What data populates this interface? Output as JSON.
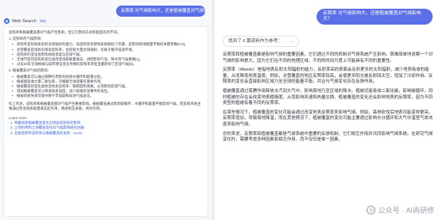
{
  "left": {
    "bubble": "反照率 对气候影响大，还是植被覆盖对气候影响大？",
    "source": "Web Search",
    "badge": "Pro",
    "intro": "反照率和植被覆盖都对气候产生影响，但它们影响方式和程度有所不同。",
    "s1": "1. 反照率的气候影响：",
    "b1": [
      "反照率是指地表反射太阳辐射的能力，高反照率会使地表吸收较少热量，是影响地球能量平衡的关键参数[4-5]。",
      "冰雪覆盖区域具有很高反照率，会反射大量太阳辐射，有助于维持低温环境。",
      "反照率的变化会影响局地温度与区域气候。",
      "全球尺度的反照率变化会改变地表能量收支，进而影响气温、降水等气候要素[1]。",
      "过去30年全球植被与城市建设变化导致的反照率改变显著影响了区域气候[6]。"
    ],
    "s2": "2. 植被覆盖对气候的影响：",
    "b2": [
      "植被覆盖可以通过蒸腾作用影响局地水循环和能量分配。",
      "植被能吸收大量二氧化碳，对缓解全球变暖有重要作用。",
      "植被覆盖的变化会改变地表反照率、粗糙度和蒸散，从而影响区域气候。",
      "增加植被覆盖可以降低地表温度，减少极端高温事件的发生。",
      "植被的损失则可能导致干旱加剧和局地气候恶化。"
    ],
    "concl": "综上所述，反照率和植被覆盖都对气候产生重要影响。植被覆盖通过影响碳循环、水循环和能量平衡影响气候，而反照率则主要通过改变地表能量收支起作用，两者相互关联、共同作用。",
    "learn": "Learn more:",
    "links": [
      "1. 青藏高原植被覆盖变化对地表反照率的影响",
      "2. 土地利用和土地覆盖变化对气候影响研究进展",
      "3. 北极苔原带反照率与植被覆盖的关系 - Acorn"
    ]
  },
  "right": {
    "bubble": "反照率 对气候影响大，还是植被覆盖对气候影响大？",
    "sources": "找到了 6 篇资料作为参考：",
    "paras": [
      "反照率和植被覆盖都是影响气候的重要因素，它们通过不同的机制对气候系统产生影响。很难简单地说哪一个对气候的影响更大，因为它们在不同的地理区域、不同的时间尺度上可能具有不同的重要性。",
      "反照率（Albedo）是指地表反射太阳辐射的能力，反射率高的表面会反射更多的太阳辐射，减少地表吸收的能量，从而降低地表温度。例如，冰雪覆盖的地区反照率较高，会使更多阳光被反射回太空，增加了冷却作用。反照率的变化会直接影响区域乃至全球的能量平衡，并且与气候变化存在反馈作用。",
      "植被覆盖通过蒸腾作用释放水汽到大气中，影响局地乃至区域的降水。植被还能吸收二氧化碳，影响碳循环，同时植被的存在会改变地表粗糙度，从而影响风速和热量交换。植被覆盖的变化还会影响地表的反照率，因为不同类型的植被有着不同的反照率。",
      "在某些情况下，植被覆盖的变化可能会通过改变地表反照率来影响气候。例如，森林砍伐后地表可能变得更亮，反照率增加，导致局地降温；而在其他情况下，植被覆盖的变化可能主要通过影响水分循环和大气中温室气体浓度来影响气候。",
      "总的来说，反照率和植被覆盖都是气候系统中重要的反馈机制，它们相互作用并共同影响气候系统。在研究气候变化时，需要考虑多种因素和相互作用，而不仅仅是单一因素。"
    ],
    "watermark": "公众号 · AI尚研修"
  }
}
